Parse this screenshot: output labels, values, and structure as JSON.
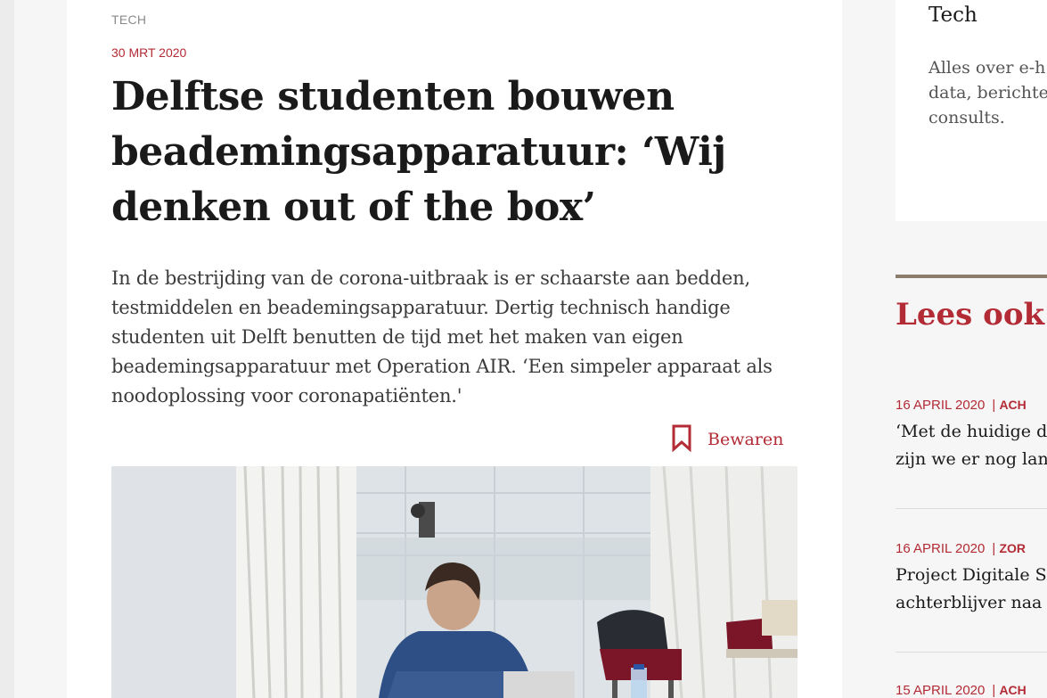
{
  "article": {
    "category": "TECH",
    "date": "30 MRT 2020",
    "headline": "Delftse studenten bouwen beademingsapparatuur: ‘Wij denken out of the box’",
    "intro": "In de bestrijding van de corona-uitbraak is er schaarste aan bedden, testmiddelen en beademingsapparatuur. Dertig technisch handige studenten uit Delft benutten de tijd met het maken van eigen beademingsapparatuur met Operation AIR. ‘Een simpeler apparaat als noodoplossing voor coronapatiënten.'",
    "save_label": "Bewaren",
    "save_icon": "bookmark-icon"
  },
  "sidebar": {
    "card_title": "Tech",
    "card_description": "Alles over e-h\ndata, berichte\nconsults.",
    "lees_ook_heading": "Lees ook",
    "related": [
      {
        "date": "16 APRIL 2020",
        "category": "ACH",
        "title": "‘Met de huidige d\nzijn we er nog lan"
      },
      {
        "date": "16 APRIL 2020",
        "category": "ZOR",
        "title": "Project Digitale S\nachterblijver naa"
      },
      {
        "date": "15 APRIL 2020",
        "category": "ACH",
        "title": ""
      }
    ]
  },
  "colors": {
    "accent": "#b32b35",
    "rule": "#8b7d6b",
    "text": "#1a1a1a",
    "muted": "#8a8a8a"
  }
}
